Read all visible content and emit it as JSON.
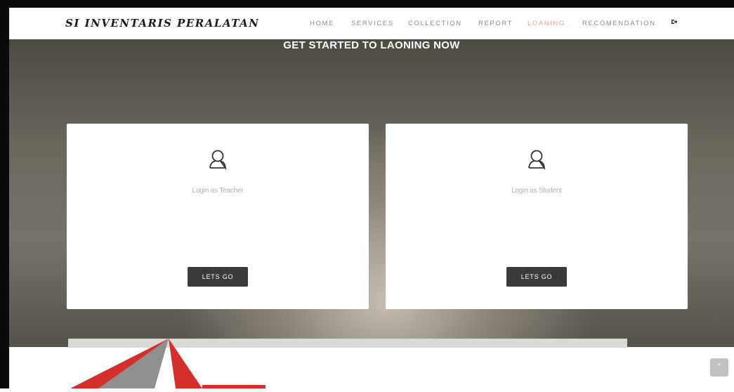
{
  "brand": "SI INVENTARIS PERALATAN",
  "nav": {
    "home": "HOME",
    "services": "SERVICES",
    "collection": "COLLECTION",
    "report": "REPORT",
    "loaning": "LOANING",
    "recomendation": "RECOMENDATION",
    "active_item": "LOANING",
    "logout_icon": "logout-icon"
  },
  "hero": {
    "title": "GET STARTED TO LAONING NOW"
  },
  "cards": [
    {
      "label": "Login as Teacher",
      "button": "LETS GO",
      "icon": "user-icon"
    },
    {
      "label": "Login as Student",
      "button": "LETS GO",
      "icon": "user-icon"
    }
  ],
  "scroll_top_icon": "chevron-up-icon",
  "colors": {
    "active_nav": "#e8a58a",
    "button_bg": "#3a3a3a",
    "watermark_red": "#d3302b",
    "watermark_gray": "#8f8f8f"
  }
}
